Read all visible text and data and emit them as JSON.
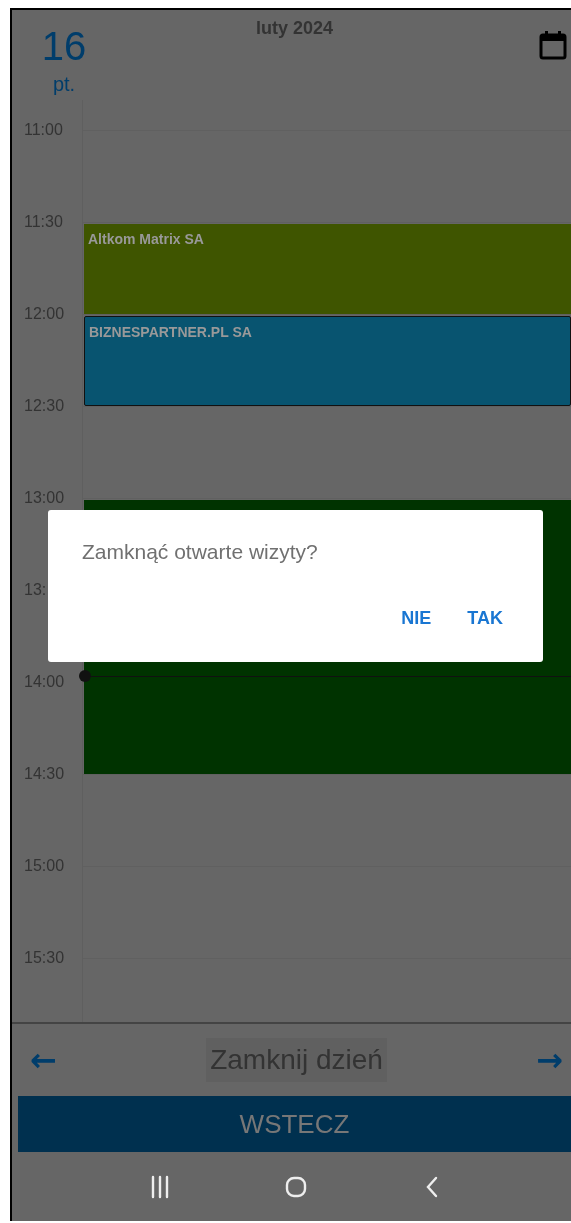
{
  "header": {
    "day_number": "16",
    "weekday": "pt.",
    "month": "luty 2024"
  },
  "time_slots": [
    {
      "label": "11:00"
    },
    {
      "label": "11:30",
      "event": {
        "title": "Altkom Matrix SA",
        "color": "#3f5500",
        "selected": false
      }
    },
    {
      "label": "12:00",
      "event": {
        "title": "BIZNESPARTNER.PL SA",
        "color": "#085470",
        "selected": true
      }
    },
    {
      "label": "12:30"
    },
    {
      "label": "13:00",
      "event": {
        "color": "#003300",
        "selected": false,
        "spans_slots": [
          {
            "label": "13:"
          },
          {
            "label": "14:00",
            "current_time": true
          }
        ]
      }
    },
    {
      "label": "14:30"
    },
    {
      "label": "15:00"
    },
    {
      "label": "15:30"
    }
  ],
  "footer": {
    "prev": "←",
    "close_day": "Zamknij dzień",
    "next": "→",
    "back": "WSTECZ"
  },
  "dialog": {
    "message": "Zamknąć otwarte wizyty?",
    "buttons": [
      "NIE",
      "TAK"
    ]
  }
}
